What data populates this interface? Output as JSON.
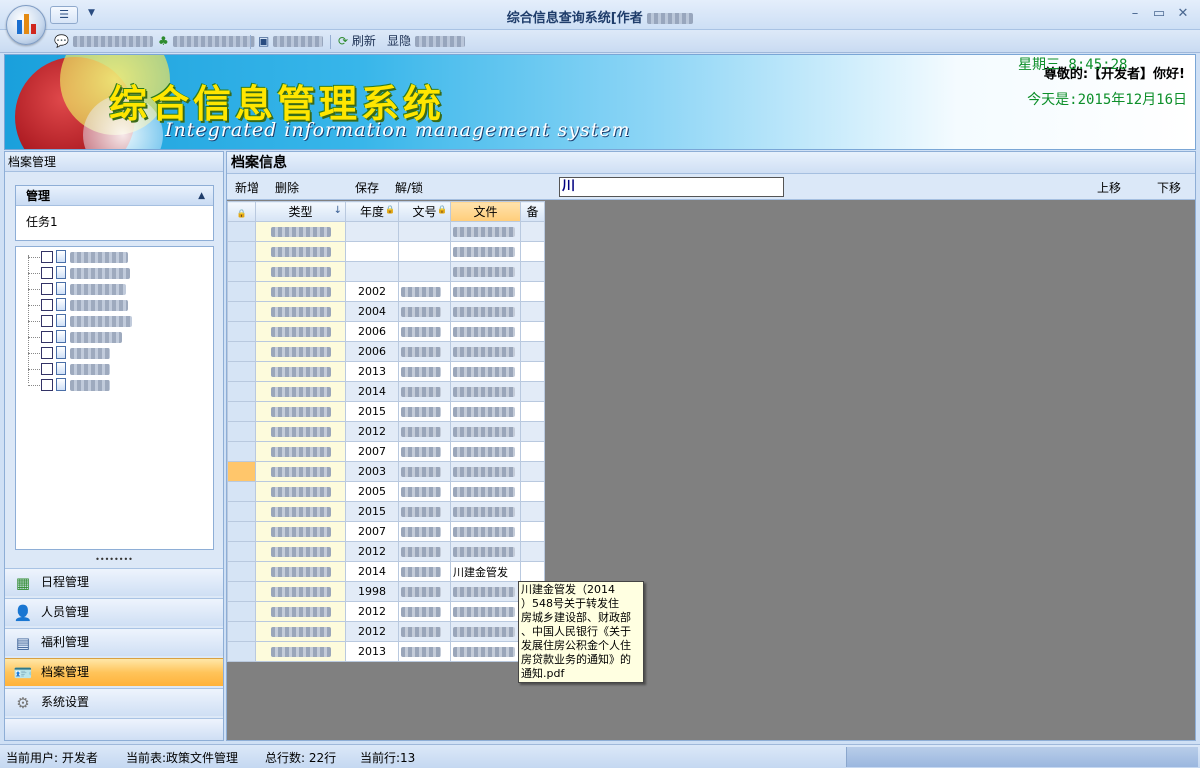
{
  "window": {
    "title": "综合信息查询系统[作者",
    "minimize": "–",
    "maximize": "▭",
    "close": "✕"
  },
  "toolbar": {
    "refresh_label": "刷新",
    "show_hide_label": "显隐"
  },
  "banner": {
    "title": "综合信息管理系统",
    "subtitle": "Integrated information management system",
    "greeting": "尊敬的:【开发者】你好!",
    "date": "今天是:2015年12月16日",
    "weekday_time": "星期三  8:45:28"
  },
  "left_panel": {
    "header": "档案管理",
    "group_title": "管理",
    "group_item": "任务1",
    "nav": [
      {
        "label": "日程管理",
        "icon": "calendar-icon"
      },
      {
        "label": "人员管理",
        "icon": "user-icon"
      },
      {
        "label": "福利管理",
        "icon": "grid-icon"
      },
      {
        "label": "档案管理",
        "icon": "id-card-icon"
      },
      {
        "label": "系统设置",
        "icon": "gear-icon"
      }
    ]
  },
  "main": {
    "header": "档案信息",
    "buttons": {
      "add": "新增",
      "delete": "删除",
      "save": "保存",
      "lock": "解/锁",
      "move_up": "上移",
      "move_down": "下移"
    },
    "search_value": "川",
    "columns": [
      "类型",
      "年度",
      "文号",
      "文件",
      "备"
    ],
    "rows": [
      {
        "year": ""
      },
      {
        "year": ""
      },
      {
        "year": ""
      },
      {
        "year": "2002"
      },
      {
        "year": "2004"
      },
      {
        "year": "2006"
      },
      {
        "year": "2006"
      },
      {
        "year": "2013"
      },
      {
        "year": "2014"
      },
      {
        "year": "2015"
      },
      {
        "year": "2012"
      },
      {
        "year": "2007"
      },
      {
        "year": "2003"
      },
      {
        "year": "2005"
      },
      {
        "year": "2015"
      },
      {
        "year": "2007"
      },
      {
        "year": "2012"
      },
      {
        "year": "2014",
        "file": "川建金管发"
      },
      {
        "year": "1998"
      },
      {
        "year": "2012"
      },
      {
        "year": "2012"
      },
      {
        "year": "2013"
      }
    ],
    "tooltip": "川建金管发（2014\n）548号关于转发住\n房城乡建设部、财政部\n、中国人民银行《关于\n发展住房公积金个人住\n房贷款业务的通知》的\n通知.pdf"
  },
  "status": {
    "user": "当前用户: 开发者",
    "table": "当前表:政策文件管理",
    "total": "总行数: 22行",
    "current": "当前行:13"
  }
}
